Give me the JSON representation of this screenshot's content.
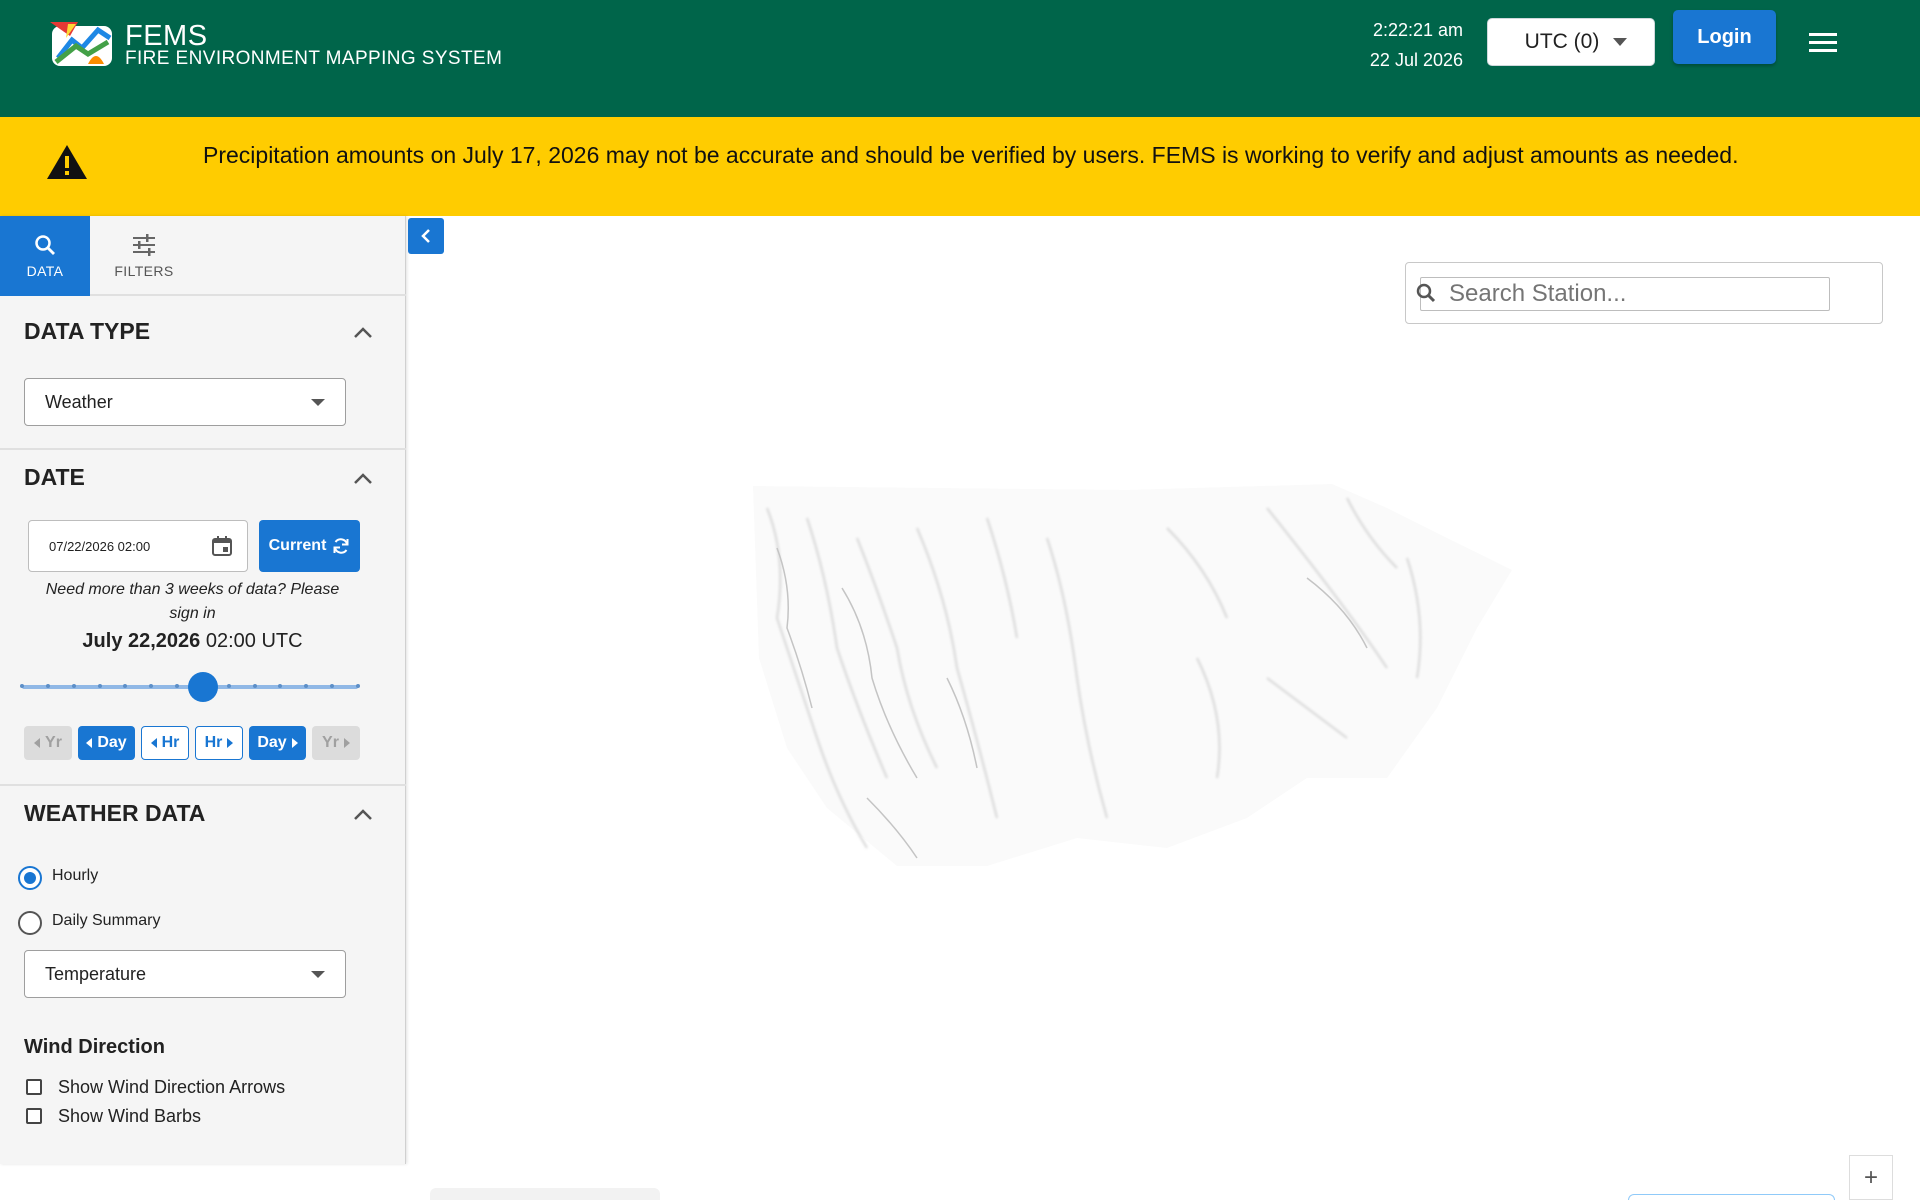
{
  "header": {
    "title": "FEMS",
    "subtitle": "FIRE ENVIRONMENT MAPPING SYSTEM",
    "time": "2:22:21 am",
    "date": "22 Jul 2026",
    "timezone": "UTC (0)",
    "login_label": "Login",
    "bg_color": "#00654a"
  },
  "banner": {
    "text": "Precipitation amounts on July 17, 2026 may not be accurate and should be verified by users. FEMS is working to verify and adjust amounts as needed.",
    "bg_color": "#ffcc00"
  },
  "tabs": {
    "data": "DATA",
    "filters": "FILTERS"
  },
  "data_type": {
    "title": "DATA TYPE",
    "selected": "Weather"
  },
  "date": {
    "title": "DATE",
    "input_value": "07/22/2026 02:00",
    "current_label": "Current",
    "hint": "Need more than 3 weeks of data? Please sign in",
    "display_date": "July 22,2026",
    "display_time": "02:00 UTC",
    "slider_fraction": 0.54,
    "steps": {
      "prev_year": "Yr",
      "prev_day": "Day",
      "prev_hour": "Hr",
      "next_hour": "Hr",
      "next_day": "Day",
      "next_year": "Yr"
    }
  },
  "weather_data": {
    "title": "WEATHER DATA",
    "options": [
      "Hourly",
      "Daily Summary"
    ],
    "selected_option": "Hourly",
    "variable": "Temperature"
  },
  "wind": {
    "title": "Wind Direction",
    "arrows_label": "Show Wind Direction Arrows",
    "barbs_label": "Show Wind Barbs"
  },
  "search": {
    "placeholder": "Search Station..."
  },
  "map": {
    "zoom_in": "+"
  },
  "colors": {
    "accent": "#1976d2",
    "header": "#00654a",
    "banner": "#ffcc00"
  }
}
